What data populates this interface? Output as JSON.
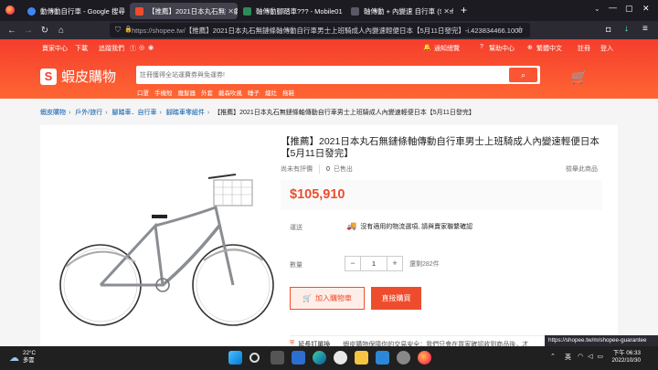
{
  "browser": {
    "tabs": [
      {
        "title": "動傳動自行車 - Google 搜尋",
        "favicon_color": "#4285f4",
        "active": false
      },
      {
        "title": "【推薦】2021日本丸石無鏈條軸",
        "favicon_color": "#ee4d2d",
        "active": true
      },
      {
        "title": "軸傳動腳踏車??? - Mobile01",
        "favicon_color": "#2e8b57",
        "active": false
      },
      {
        "title": "軸傳動 + 內變速 自行車 (Shef",
        "favicon_color": "#5a5a66",
        "active": false
      }
    ],
    "new_tab": "+",
    "url_host": "https://shopee.tw/",
    "url_rest": "【推薦】2021日本丸石無鏈條軸傳動自行車男士上班騎成人內變速輕便日本【5月11日發完】-i.423834466.1000"
  },
  "shopee": {
    "top_left": [
      "賣家中心",
      "下載",
      "追蹤我們"
    ],
    "top_right": [
      "通知總覽",
      "幫助中心",
      "繁體中文",
      "註冊",
      "登入"
    ],
    "logo_text": "蝦皮購物",
    "search_placeholder": "註冊獲得全站運費券與免運券!",
    "hotwords": [
      "口罩",
      "手機殼",
      "魔髮器",
      "外套",
      "戴森吹風",
      "睡子",
      "爐灶",
      "拖鞋"
    ]
  },
  "breadcrumb": {
    "items": [
      "蝦皮購物",
      "戶外/旅行",
      "腳踏車．自行車",
      "腳踏車零組件"
    ],
    "current": "【推薦】2021日本丸石無鏈條軸傳動自行車男士上班騎成人內變速輕便日本【5月11日發完】"
  },
  "product": {
    "title": "【推薦】2021日本丸石無鏈條軸傳動自行車男士上班騎成人內變速輕便日本【5月11日發完】",
    "no_reviews": "尚未有評價",
    "sold_count": "0",
    "sold_label": "已售出",
    "report": "檢舉此商品",
    "price": "$105,910",
    "shipping_label": "運送",
    "shipping_text": "沒有適用的物流選項, 請與賣家聯繫確認",
    "quantity_label": "數量",
    "qty_minus": "−",
    "qty_value": "1",
    "qty_plus": "+",
    "stock": "還剩282件",
    "add_to_cart": "加入購物車",
    "buy_now": "直接購買",
    "guarantee_title": "延長訂單換",
    "guarantee_text": "蝦皮購物保障你的交易安全：我們只會在買家確認收到商品後，才"
  },
  "status_url": "https://shopee.tw/m/shopee-guarantee",
  "taskbar": {
    "temp": "22°C",
    "condition": "多雲",
    "ime": "英",
    "time": "下午 06:33",
    "date": "2022/10/30"
  },
  "colors": {
    "brand": "#ee4d2d",
    "header": "#f53d2d"
  }
}
